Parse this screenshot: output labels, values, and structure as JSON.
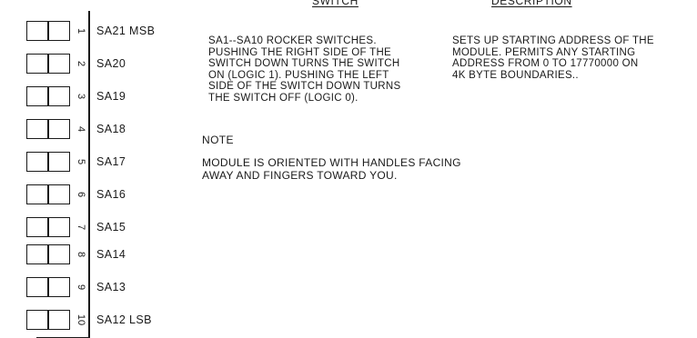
{
  "headers": {
    "switch": "SWITCH",
    "description": "DESCRIPTION"
  },
  "switches": [
    {
      "number": "1",
      "label": "SA21  MSB"
    },
    {
      "number": "2",
      "label": "SA20"
    },
    {
      "number": "3",
      "label": "SA19"
    },
    {
      "number": "4",
      "label": "SA18"
    },
    {
      "number": "5",
      "label": "SA17"
    },
    {
      "number": "6",
      "label": "SA16"
    },
    {
      "number": "7",
      "label": "SA15"
    },
    {
      "number": "8",
      "label": "SA14"
    },
    {
      "number": "9",
      "label": "SA13"
    },
    {
      "number": "10",
      "label": "SA12  LSB"
    }
  ],
  "function_text": "SA1--SA10 ROCKER SWITCHES.\nPUSHING  THE RIGHT  SIDE OF THE\nSWITCH DOWN TURNS THE SWITCH\nON (LOGIC 1).  PUSHING  THE LEFT\nSIDE OF  THE SWITCH DOWN TURNS\nTHE SWITCH OFF (LOGIC 0).",
  "description_text": "SETS UP STARTING ADDRESS OF THE\nMODULE.  PERMITS ANY STARTING\nADDRESS FROM 0 TO 17770000 ON\n4K BYTE BOUNDARIES..",
  "note": {
    "title": "NOTE",
    "text": "MODULE IS ORIENTED WITH HANDLES FACING\nAWAY AND FINGERS TOWARD YOU."
  }
}
